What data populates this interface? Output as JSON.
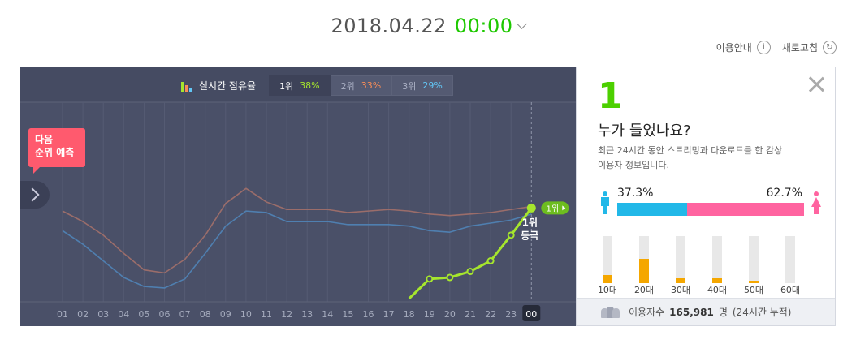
{
  "header": {
    "date": "2018.04.22",
    "time": "00:00"
  },
  "links": {
    "guide": "이용안내",
    "guide_icon": "info-icon",
    "refresh": "새로고침",
    "refresh_icon": "refresh-icon"
  },
  "legend": {
    "title": "실시간 점유율",
    "ranks": [
      {
        "label": "1위",
        "pct": "38%",
        "color": "#a6e62d",
        "active": true
      },
      {
        "label": "2위",
        "pct": "33%",
        "color": "#f98d57",
        "active": false
      },
      {
        "label": "3위",
        "pct": "29%",
        "color": "#62c6f5",
        "active": false
      }
    ]
  },
  "predict": {
    "line1": "다음",
    "line2": "순위 예측"
  },
  "chart_data": {
    "type": "line",
    "categories": [
      "01",
      "02",
      "03",
      "04",
      "05",
      "06",
      "07",
      "08",
      "09",
      "10",
      "11",
      "12",
      "13",
      "14",
      "15",
      "16",
      "17",
      "18",
      "19",
      "20",
      "21",
      "22",
      "23",
      "00"
    ],
    "highlight_category": "00",
    "series": [
      {
        "name": "1위",
        "color": "#a6e62d",
        "values": [
          null,
          null,
          null,
          null,
          null,
          null,
          null,
          null,
          null,
          null,
          null,
          null,
          null,
          null,
          null,
          null,
          null,
          0,
          13,
          14,
          18,
          25,
          42,
          60
        ]
      },
      {
        "name": "2위",
        "color": "#9b6d6a",
        "values": [
          58,
          51,
          42,
          30,
          19,
          17,
          26,
          42,
          63,
          73,
          64,
          59,
          59,
          59,
          57,
          58,
          59,
          58,
          56,
          55,
          56,
          57,
          59,
          61
        ]
      },
      {
        "name": "3위",
        "color": "#4f7fb0",
        "values": [
          45,
          36,
          25,
          14,
          8,
          7,
          13,
          30,
          48,
          58,
          57,
          51,
          51,
          51,
          49,
          49,
          49,
          48,
          45,
          44,
          48,
          50,
          52,
          56
        ]
      }
    ],
    "end_labels": {
      "badge": "1위",
      "line1": "1위",
      "line2": "등극"
    },
    "ylim": [
      0,
      100
    ]
  },
  "info": {
    "rank": "1",
    "title": "누가 들었나요?",
    "desc": "최근 24시간 동안 스트리밍과 다운로드를 한 감상 이용자 정보입니다.",
    "gender": {
      "male_pct": 37.3,
      "female_pct": 62.7,
      "male_label": "37.3%",
      "female_label": "62.7%"
    },
    "ages": [
      {
        "label": "10대",
        "value": 18
      },
      {
        "label": "20대",
        "value": 52
      },
      {
        "label": "30대",
        "value": 10
      },
      {
        "label": "40대",
        "value": 10
      },
      {
        "label": "50대",
        "value": 5
      },
      {
        "label": "60대",
        "value": 0
      }
    ],
    "users": {
      "label": "이용자수",
      "count": "165,981",
      "unit": "명",
      "note": "(24시간 누적)"
    }
  }
}
